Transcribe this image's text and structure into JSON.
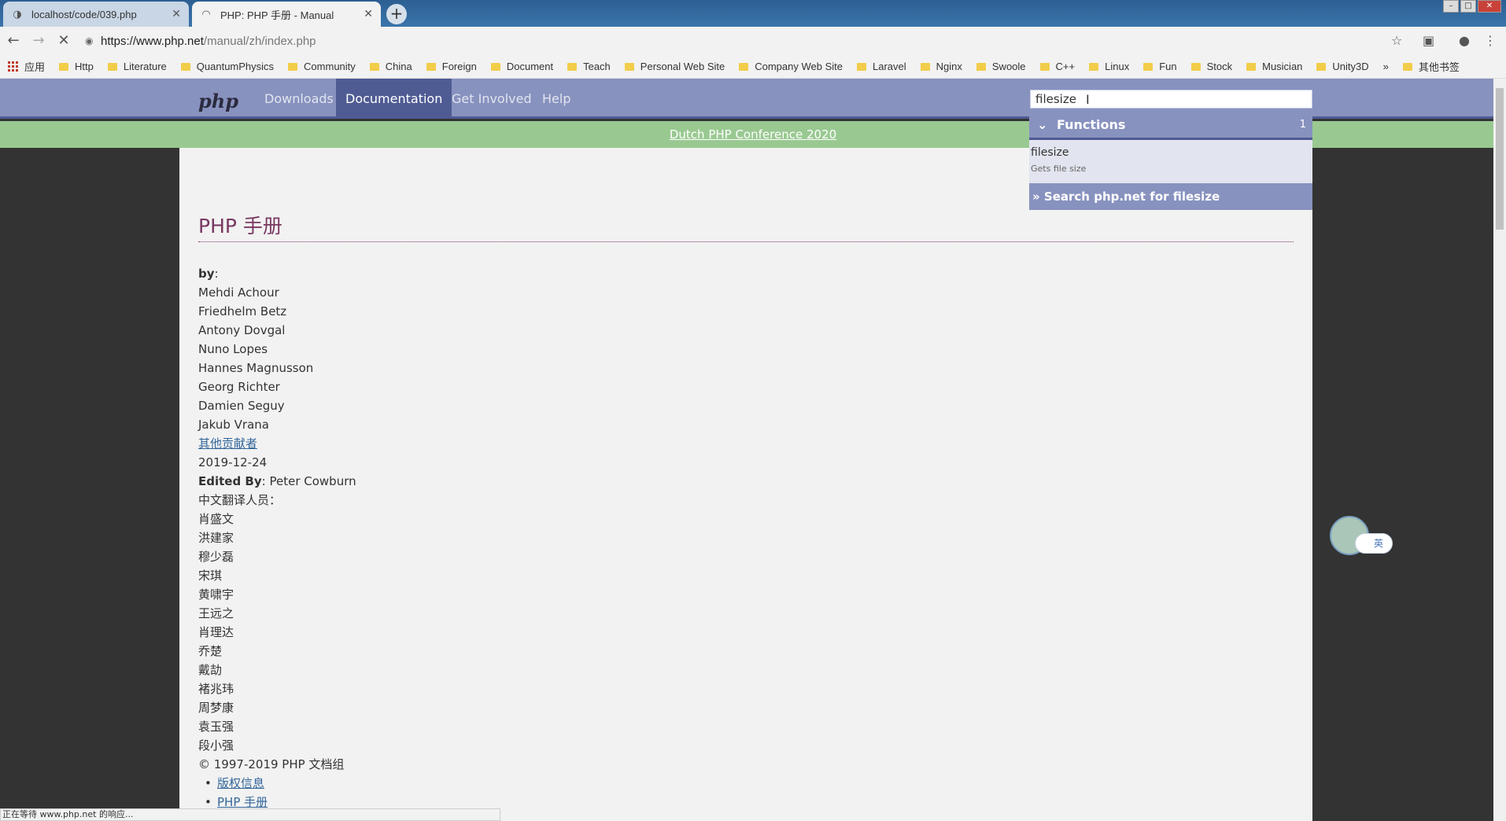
{
  "tabs": [
    {
      "title": "localhost/code/039.php",
      "icon": "globe-icon"
    },
    {
      "title": "PHP: PHP 手册 - Manual",
      "icon": "loading-icon"
    }
  ],
  "address": {
    "host": "https://www.php.net",
    "path": "/manual/zh/index.php"
  },
  "bookmarks": {
    "apps_label": "应用",
    "items": [
      "Http",
      "Literature",
      "QuantumPhysics",
      "Community",
      "China",
      "Foreign",
      "Document",
      "Teach",
      "Personal Web Site",
      "Company Web Site",
      "Laravel",
      "Nginx",
      "Swoole",
      "C++",
      "Linux",
      "Fun",
      "Stock",
      "Musician",
      "Unity3D"
    ],
    "more": "»",
    "other": "其他书签"
  },
  "php_nav": {
    "logo": "php",
    "links": [
      "Downloads",
      "Documentation",
      "Get Involved",
      "Help"
    ],
    "active": "Documentation",
    "search_value": "filesize"
  },
  "banner": "Dutch PHP Conference 2020",
  "autocomplete": {
    "group": "Functions",
    "count": "1",
    "item_name": "filesize",
    "item_desc": "Gets file size",
    "search_all": "» Search php.net for filesize"
  },
  "content": {
    "title": "PHP 手册",
    "by_label": "by",
    "authors": [
      "Mehdi Achour",
      "Friedhelm Betz",
      "Antony Dovgal",
      "Nuno Lopes",
      "Hannes Magnusson",
      "Georg Richter",
      "Damien Seguy",
      "Jakub Vrana"
    ],
    "other_contributors": "其他贡献者",
    "date": "2019-12-24",
    "edited_by_label": "Edited By",
    "edited_by": "Peter Cowburn",
    "translators_label": "中文翻译人员：",
    "translators": [
      "肖盛文",
      "洪建家",
      "穆少磊",
      "宋琪",
      "黄啸宇",
      "王远之",
      "肖理达",
      "乔楚",
      "戴劼",
      "褚兆玮",
      "周梦康",
      "袁玉强",
      "段小强"
    ],
    "copyright": "© 1997-2019 PHP 文档组",
    "list": [
      "版权信息",
      "PHP 手册"
    ]
  },
  "float_widget": {
    "label": "英"
  },
  "status_text": "正在等待 www.php.net 的响应..."
}
